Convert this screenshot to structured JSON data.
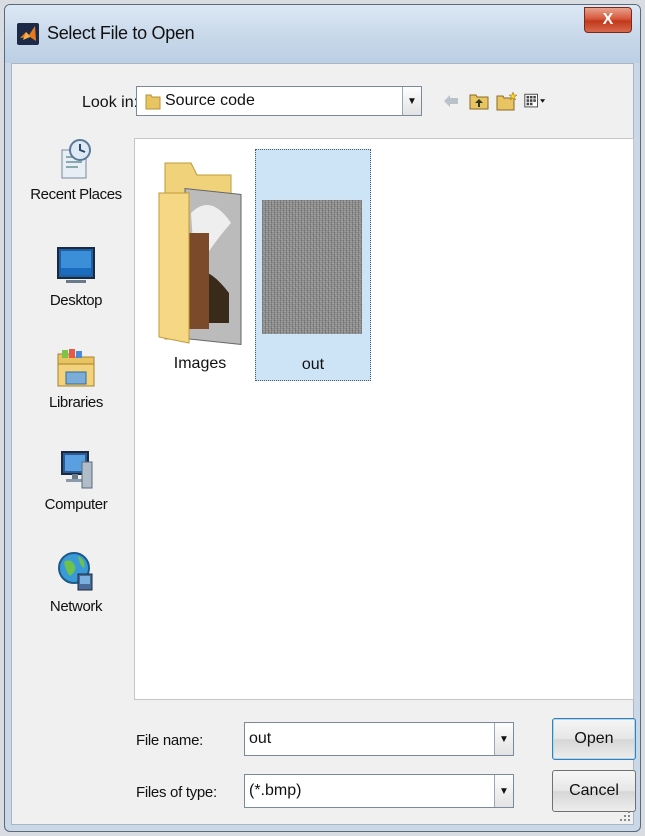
{
  "window": {
    "title": "Select File to Open",
    "close_label": "X"
  },
  "lookin": {
    "label": "Look in:",
    "value": "Source code"
  },
  "toolbar": {
    "icons": [
      "back-arrow-icon",
      "up-folder-icon",
      "new-folder-icon",
      "view-menu-icon"
    ]
  },
  "places": [
    {
      "label": "Recent Places",
      "icon": "recent-places-icon"
    },
    {
      "label": "Desktop",
      "icon": "desktop-icon"
    },
    {
      "label": "Libraries",
      "icon": "libraries-icon"
    },
    {
      "label": "Computer",
      "icon": "computer-icon"
    },
    {
      "label": "Network",
      "icon": "network-icon"
    }
  ],
  "files": [
    {
      "name": "Images",
      "type": "folder",
      "selected": false
    },
    {
      "name": "out",
      "type": "image",
      "selected": true
    }
  ],
  "filename": {
    "label": "File name:",
    "value": "out"
  },
  "filetype": {
    "label": "Files of type:",
    "value": "(*.bmp)"
  },
  "buttons": {
    "open": "Open",
    "cancel": "Cancel"
  },
  "colors": {
    "titlebar": "#c8d8ea",
    "close": "#c2381b",
    "selection": "#cde4f7"
  }
}
